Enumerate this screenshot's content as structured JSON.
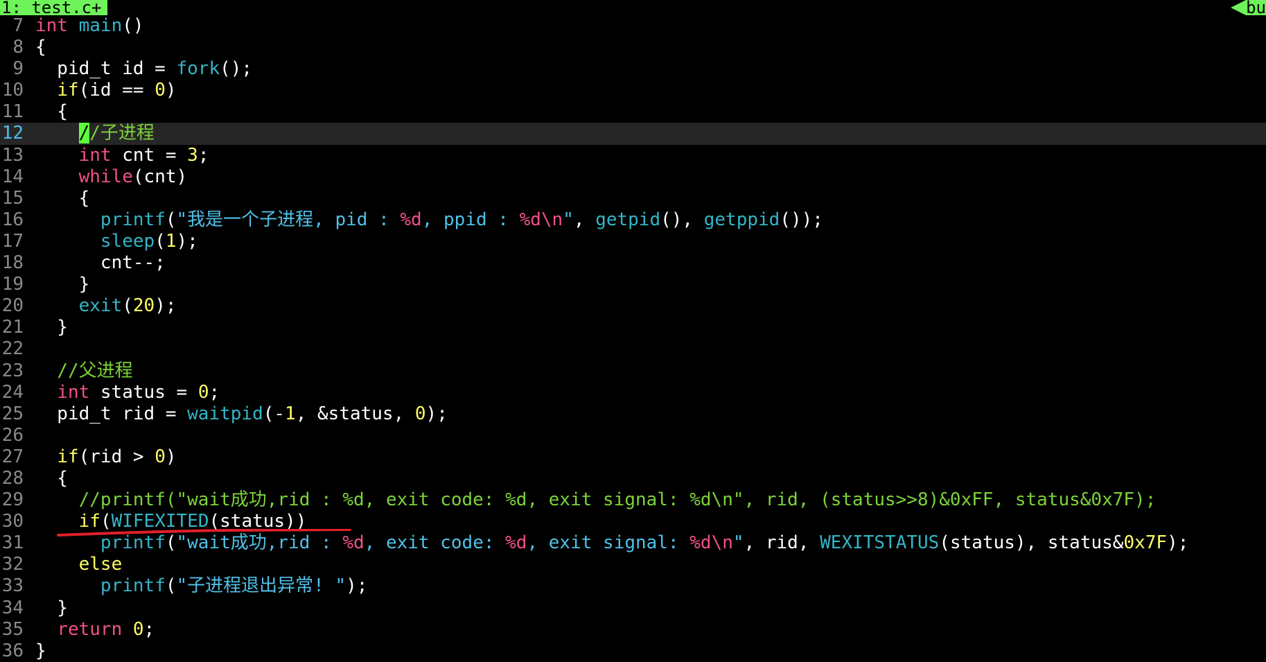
{
  "tabline": {
    "active_tab": "1: test.c+",
    "right_tab": "bu"
  },
  "colors": {
    "background": "#000000",
    "tab_green": "#6ef35a",
    "keyword": "#f0508a",
    "function": "#33b5c8",
    "number": "#ffff66",
    "string": "#4fc1e9",
    "comment": "#7cd33a",
    "annotation": "#e0202a"
  },
  "editor": {
    "current_line": 12,
    "lines": [
      {
        "n": "7",
        "tokens": [
          [
            "kw",
            "int"
          ],
          [
            "t",
            " "
          ],
          [
            "fn",
            "main"
          ],
          [
            "t",
            "()"
          ]
        ]
      },
      {
        "n": "8",
        "tokens": [
          [
            "t",
            "{"
          ]
        ]
      },
      {
        "n": "9",
        "tokens": [
          [
            "t",
            "  pid_t id = "
          ],
          [
            "fn",
            "fork"
          ],
          [
            "t",
            "();"
          ]
        ]
      },
      {
        "n": "10",
        "tokens": [
          [
            "t",
            "  "
          ],
          [
            "num",
            "if"
          ],
          [
            "t",
            "(id == "
          ],
          [
            "num",
            "0"
          ],
          [
            "t",
            ")"
          ]
        ]
      },
      {
        "n": "11",
        "tokens": [
          [
            "t",
            "  {"
          ]
        ]
      },
      {
        "n": "12",
        "tokens": [
          [
            "t",
            "    "
          ],
          [
            "cursor",
            "/"
          ],
          [
            "cm",
            "/子进程"
          ]
        ]
      },
      {
        "n": "13",
        "tokens": [
          [
            "t",
            "    "
          ],
          [
            "kw",
            "int"
          ],
          [
            "t",
            " cnt = "
          ],
          [
            "num",
            "3"
          ],
          [
            "t",
            ";"
          ]
        ]
      },
      {
        "n": "14",
        "tokens": [
          [
            "t",
            "    "
          ],
          [
            "kw",
            "while"
          ],
          [
            "t",
            "(cnt)"
          ]
        ]
      },
      {
        "n": "15",
        "tokens": [
          [
            "t",
            "    {"
          ]
        ]
      },
      {
        "n": "16",
        "tokens": [
          [
            "t",
            "      "
          ],
          [
            "fn",
            "printf"
          ],
          [
            "t",
            "("
          ],
          [
            "str",
            "\"我是一个子进程, pid : "
          ],
          [
            "fmt",
            "%d"
          ],
          [
            "str",
            ", ppid : "
          ],
          [
            "fmt",
            "%d\\n"
          ],
          [
            "str",
            "\""
          ],
          [
            "t",
            ", "
          ],
          [
            "fn",
            "getpid"
          ],
          [
            "t",
            "(), "
          ],
          [
            "fn",
            "getppid"
          ],
          [
            "t",
            "());"
          ]
        ]
      },
      {
        "n": "17",
        "tokens": [
          [
            "t",
            "      "
          ],
          [
            "fn",
            "sleep"
          ],
          [
            "t",
            "("
          ],
          [
            "num",
            "1"
          ],
          [
            "t",
            ");"
          ]
        ]
      },
      {
        "n": "18",
        "tokens": [
          [
            "t",
            "      cnt--;"
          ]
        ]
      },
      {
        "n": "19",
        "tokens": [
          [
            "t",
            "    }"
          ]
        ]
      },
      {
        "n": "20",
        "tokens": [
          [
            "t",
            "    "
          ],
          [
            "fn",
            "exit"
          ],
          [
            "t",
            "("
          ],
          [
            "num",
            "20"
          ],
          [
            "t",
            ");"
          ]
        ]
      },
      {
        "n": "21",
        "tokens": [
          [
            "t",
            "  }"
          ]
        ]
      },
      {
        "n": "22",
        "tokens": [
          [
            "t",
            ""
          ]
        ]
      },
      {
        "n": "23",
        "tokens": [
          [
            "t",
            "  "
          ],
          [
            "cm",
            "//父进程"
          ]
        ]
      },
      {
        "n": "24",
        "tokens": [
          [
            "t",
            "  "
          ],
          [
            "kw",
            "int"
          ],
          [
            "t",
            " status = "
          ],
          [
            "num",
            "0"
          ],
          [
            "t",
            ";"
          ]
        ]
      },
      {
        "n": "25",
        "tokens": [
          [
            "t",
            "  pid_t rid = "
          ],
          [
            "fn",
            "waitpid"
          ],
          [
            "t",
            "(-"
          ],
          [
            "num",
            "1"
          ],
          [
            "t",
            ", &status, "
          ],
          [
            "num",
            "0"
          ],
          [
            "t",
            ");"
          ]
        ]
      },
      {
        "n": "26",
        "tokens": [
          [
            "t",
            ""
          ]
        ]
      },
      {
        "n": "27",
        "tokens": [
          [
            "t",
            "  "
          ],
          [
            "num",
            "if"
          ],
          [
            "t",
            "(rid > "
          ],
          [
            "num",
            "0"
          ],
          [
            "t",
            ")"
          ]
        ]
      },
      {
        "n": "28",
        "tokens": [
          [
            "t",
            "  {"
          ]
        ]
      },
      {
        "n": "29",
        "tokens": [
          [
            "t",
            "    "
          ],
          [
            "cm",
            "//printf(\"wait成功,rid : %d, exit code: %d, exit signal: %d\\n\", rid, (status>>8)&0xFF, status&0x7F);"
          ]
        ]
      },
      {
        "n": "30",
        "tokens": [
          [
            "t",
            "    "
          ],
          [
            "num",
            "if"
          ],
          [
            "t",
            "("
          ],
          [
            "fn",
            "WIFEXITED"
          ],
          [
            "t",
            "(status))"
          ]
        ]
      },
      {
        "n": "31",
        "tokens": [
          [
            "t",
            "      "
          ],
          [
            "fn",
            "printf"
          ],
          [
            "t",
            "("
          ],
          [
            "str",
            "\"wait成功,rid : "
          ],
          [
            "fmt",
            "%d"
          ],
          [
            "str",
            ", exit code: "
          ],
          [
            "fmt",
            "%d"
          ],
          [
            "str",
            ", exit signal: "
          ],
          [
            "fmt",
            "%d\\n"
          ],
          [
            "str",
            "\""
          ],
          [
            "t",
            ", rid, "
          ],
          [
            "fn",
            "WEXITSTATUS"
          ],
          [
            "t",
            "(status), status&"
          ],
          [
            "num",
            "0x7F"
          ],
          [
            "t",
            ");"
          ]
        ]
      },
      {
        "n": "32",
        "tokens": [
          [
            "t",
            "    "
          ],
          [
            "num",
            "else"
          ]
        ]
      },
      {
        "n": "33",
        "tokens": [
          [
            "t",
            "      "
          ],
          [
            "fn",
            "printf"
          ],
          [
            "t",
            "("
          ],
          [
            "str",
            "\"子进程退出异常! \""
          ],
          [
            "t",
            ");"
          ]
        ]
      },
      {
        "n": "34",
        "tokens": [
          [
            "t",
            "  }"
          ]
        ]
      },
      {
        "n": "35",
        "tokens": [
          [
            "t",
            "  "
          ],
          [
            "kw",
            "return"
          ],
          [
            "t",
            " "
          ],
          [
            "num",
            "0"
          ],
          [
            "t",
            ";"
          ]
        ]
      },
      {
        "n": "36",
        "tokens": [
          [
            "t",
            "}"
          ]
        ]
      }
    ]
  },
  "annotation": {
    "type": "red-hand-drawn-underline",
    "target_line": 30
  }
}
